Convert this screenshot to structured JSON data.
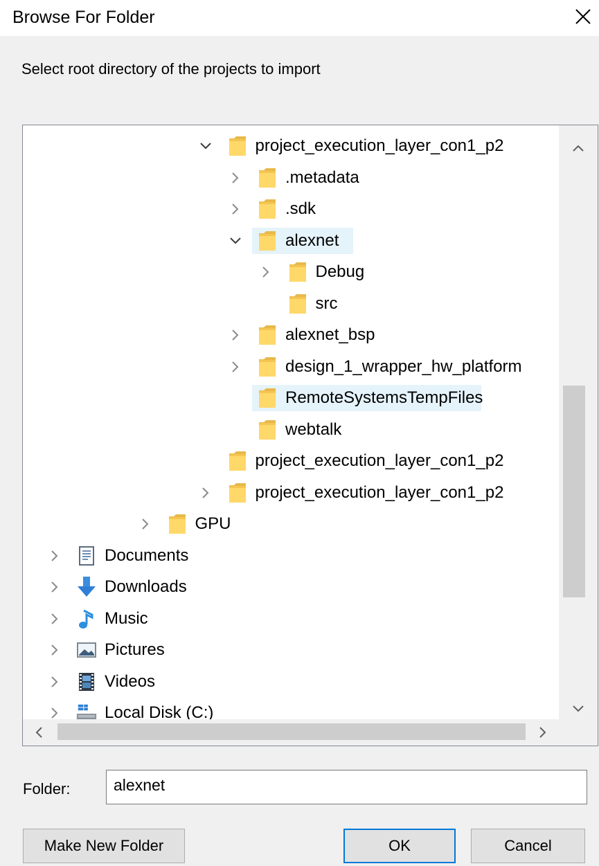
{
  "window": {
    "title": "Browse For Folder",
    "close_glyph": "✕"
  },
  "instruction": "Select root directory of the projects to import",
  "tree": {
    "items": [
      {
        "label": "project_execution_layer_con1_p2",
        "depth": 6,
        "expander": "expanded",
        "icon": "folder-icon"
      },
      {
        "label": ".metadata",
        "depth": 7,
        "expander": "collapsed",
        "icon": "folder-icon"
      },
      {
        "label": ".sdk",
        "depth": 7,
        "expander": "collapsed",
        "icon": "folder-icon"
      },
      {
        "label": "alexnet",
        "depth": 7,
        "expander": "expanded",
        "icon": "folder-icon",
        "state": "selected"
      },
      {
        "label": "Debug",
        "depth": 8,
        "expander": "collapsed",
        "icon": "folder-icon"
      },
      {
        "label": "src",
        "depth": 8,
        "expander": "none",
        "icon": "folder-icon"
      },
      {
        "label": "alexnet_bsp",
        "depth": 7,
        "expander": "collapsed",
        "icon": "folder-icon"
      },
      {
        "label": "design_1_wrapper_hw_platform",
        "depth": 7,
        "expander": "collapsed",
        "icon": "folder-icon"
      },
      {
        "label": "RemoteSystemsTempFiles",
        "depth": 7,
        "expander": "none",
        "icon": "folder-icon",
        "state": "hover"
      },
      {
        "label": "webtalk",
        "depth": 7,
        "expander": "none",
        "icon": "folder-icon"
      },
      {
        "label": "project_execution_layer_con1_p2",
        "depth": 6,
        "expander": "none",
        "icon": "folder-icon"
      },
      {
        "label": "project_execution_layer_con1_p2",
        "depth": 6,
        "expander": "collapsed",
        "icon": "folder-icon"
      },
      {
        "label": "GPU",
        "depth": 4,
        "expander": "collapsed",
        "icon": "folder-icon"
      },
      {
        "label": "Documents",
        "depth": 1,
        "expander": "collapsed",
        "icon": "documents-icon"
      },
      {
        "label": "Downloads",
        "depth": 1,
        "expander": "collapsed",
        "icon": "downloads-icon"
      },
      {
        "label": "Music",
        "depth": 1,
        "expander": "collapsed",
        "icon": "music-icon"
      },
      {
        "label": "Pictures",
        "depth": 1,
        "expander": "collapsed",
        "icon": "pictures-icon"
      },
      {
        "label": "Videos",
        "depth": 1,
        "expander": "collapsed",
        "icon": "videos-icon"
      },
      {
        "label": "Local Disk (C:)",
        "depth": 1,
        "expander": "collapsed",
        "icon": "local-disk-icon"
      }
    ]
  },
  "folder_field": {
    "label": "Folder:",
    "value": "alexnet"
  },
  "buttons": {
    "make_new_folder": "Make New Folder",
    "ok": "OK",
    "cancel": "Cancel"
  },
  "colors": {
    "selection": "#e5f3fb",
    "default_button_border": "#0078d7",
    "folder_fill": "#ffd86a"
  }
}
